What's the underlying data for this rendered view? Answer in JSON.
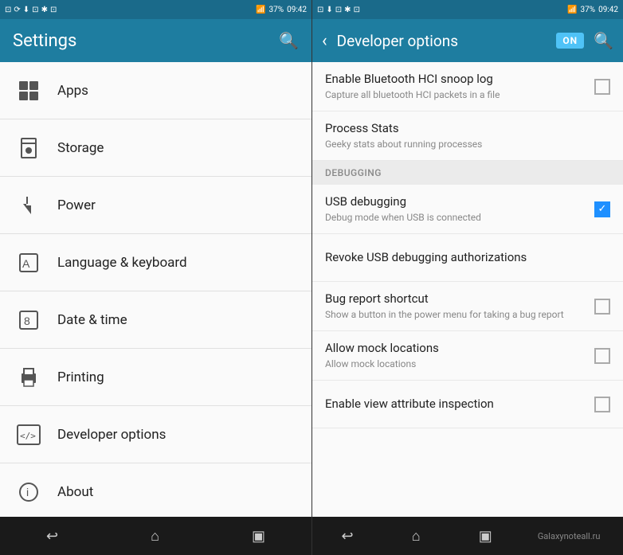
{
  "left": {
    "statusBar": {
      "leftIcons": "⊡ ⟳ ⬇ ⊡ 🔔",
      "rightIcons": "✱ ⊡ 📶 37% 09:42"
    },
    "header": {
      "title": "Settings",
      "searchLabel": "search"
    },
    "menuItems": [
      {
        "id": "apps",
        "label": "Apps",
        "icon": "grid"
      },
      {
        "id": "storage",
        "label": "Storage",
        "icon": "storage"
      },
      {
        "id": "power",
        "label": "Power",
        "icon": "power"
      },
      {
        "id": "language",
        "label": "Language & keyboard",
        "icon": "keyboard"
      },
      {
        "id": "datetime",
        "label": "Date & time",
        "icon": "datetime"
      },
      {
        "id": "printing",
        "label": "Printing",
        "icon": "print"
      },
      {
        "id": "developer",
        "label": "Developer options",
        "icon": "dev"
      },
      {
        "id": "about",
        "label": "About",
        "icon": "about"
      }
    ],
    "navBar": {
      "back": "↩",
      "home": "⌂",
      "recent": "▣"
    }
  },
  "right": {
    "statusBar": {
      "leftIcons": "⊡ ⬇ ⊡ ✱ 📶 37% 09:42"
    },
    "header": {
      "backLabel": "back",
      "title": "Developer options",
      "toggleLabel": "ON",
      "searchLabel": "search"
    },
    "items": [
      {
        "id": "bluetooth-hci",
        "title": "Enable Bluetooth HCI snoop log",
        "subtitle": "Capture all bluetooth HCI packets in a file",
        "hasCheckbox": true,
        "checked": false
      },
      {
        "id": "process-stats",
        "title": "Process Stats",
        "subtitle": "Geeky stats about running processes",
        "hasCheckbox": false,
        "checked": false
      }
    ],
    "debuggingSection": {
      "label": "DEBUGGING"
    },
    "debugItems": [
      {
        "id": "usb-debugging",
        "title": "USB debugging",
        "subtitle": "Debug mode when USB is connected",
        "hasCheckbox": true,
        "checked": true
      },
      {
        "id": "revoke-usb",
        "title": "Revoke USB debugging authorizations",
        "subtitle": "",
        "hasCheckbox": false,
        "checked": false
      },
      {
        "id": "bug-report",
        "title": "Bug report shortcut",
        "subtitle": "Show a button in the power menu for taking a bug report",
        "hasCheckbox": true,
        "checked": false
      },
      {
        "id": "mock-locations",
        "title": "Allow mock locations",
        "subtitle": "Allow mock locations",
        "hasCheckbox": true,
        "checked": false
      },
      {
        "id": "view-attribute",
        "title": "Enable view attribute inspection",
        "subtitle": "",
        "hasCheckbox": true,
        "checked": false
      }
    ],
    "navBar": {
      "back": "↩",
      "home": "⌂",
      "recent": "▣",
      "watermark": "Galaxynoteall.ru"
    }
  }
}
